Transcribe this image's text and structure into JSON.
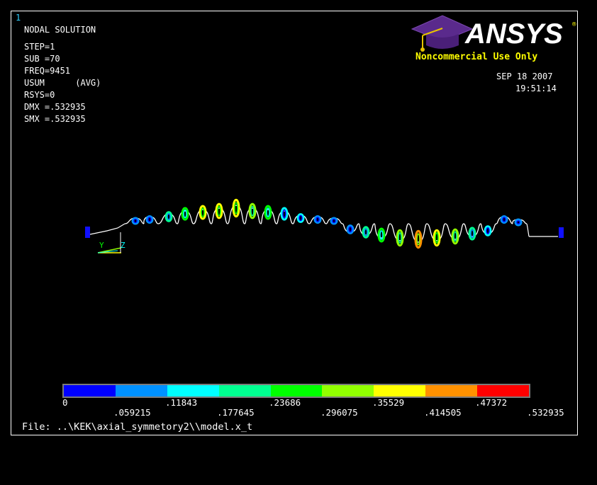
{
  "window_number": "1",
  "info": {
    "title": "NODAL SOLUTION",
    "lines": [
      "STEP=1",
      "SUB =70",
      "FREQ=9451",
      "USUM      (AVG)",
      "RSYS=0",
      "DMX =.532935",
      "SMX =.532935"
    ]
  },
  "logo": {
    "brand": "ANSYS",
    "registered": "®",
    "subtitle": "Noncommercial Use Only"
  },
  "datetime": {
    "date": "SEP 18 2007",
    "time": "19:51:14"
  },
  "triad": {
    "y": "Y",
    "z": "Z"
  },
  "legend": {
    "colors": [
      "#0000ff",
      "#0091ff",
      "#00ffff",
      "#00ff91",
      "#00ff00",
      "#91ff00",
      "#ffff00",
      "#ff9100",
      "#ff0000"
    ],
    "labels_top": [
      "0",
      ".11843",
      ".23686",
      ".35529",
      ".47372"
    ],
    "labels_bottom": [
      ".059215",
      ".177645",
      ".296075",
      ".414505",
      ".532935"
    ]
  },
  "file": "File: ..\\KEK\\axial_symmetory2\\\\model.x_t"
}
